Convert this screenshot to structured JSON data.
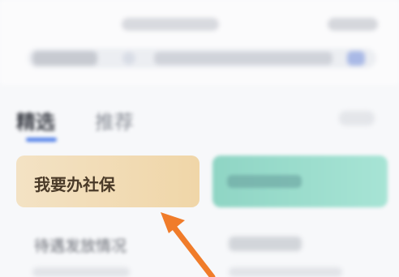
{
  "tabs": [
    {
      "label": "精选",
      "active": true
    },
    {
      "label": "推荐",
      "active": false
    }
  ],
  "cards": [
    {
      "label": "我要办社保",
      "color": "#f0d6a8"
    },
    {
      "label": "",
      "color": "#9ddccc"
    }
  ],
  "lower_row": {
    "left_text": "待遇发放情况"
  },
  "colors": {
    "accent": "#4f7ee8",
    "arrow": "#f07c2a"
  }
}
